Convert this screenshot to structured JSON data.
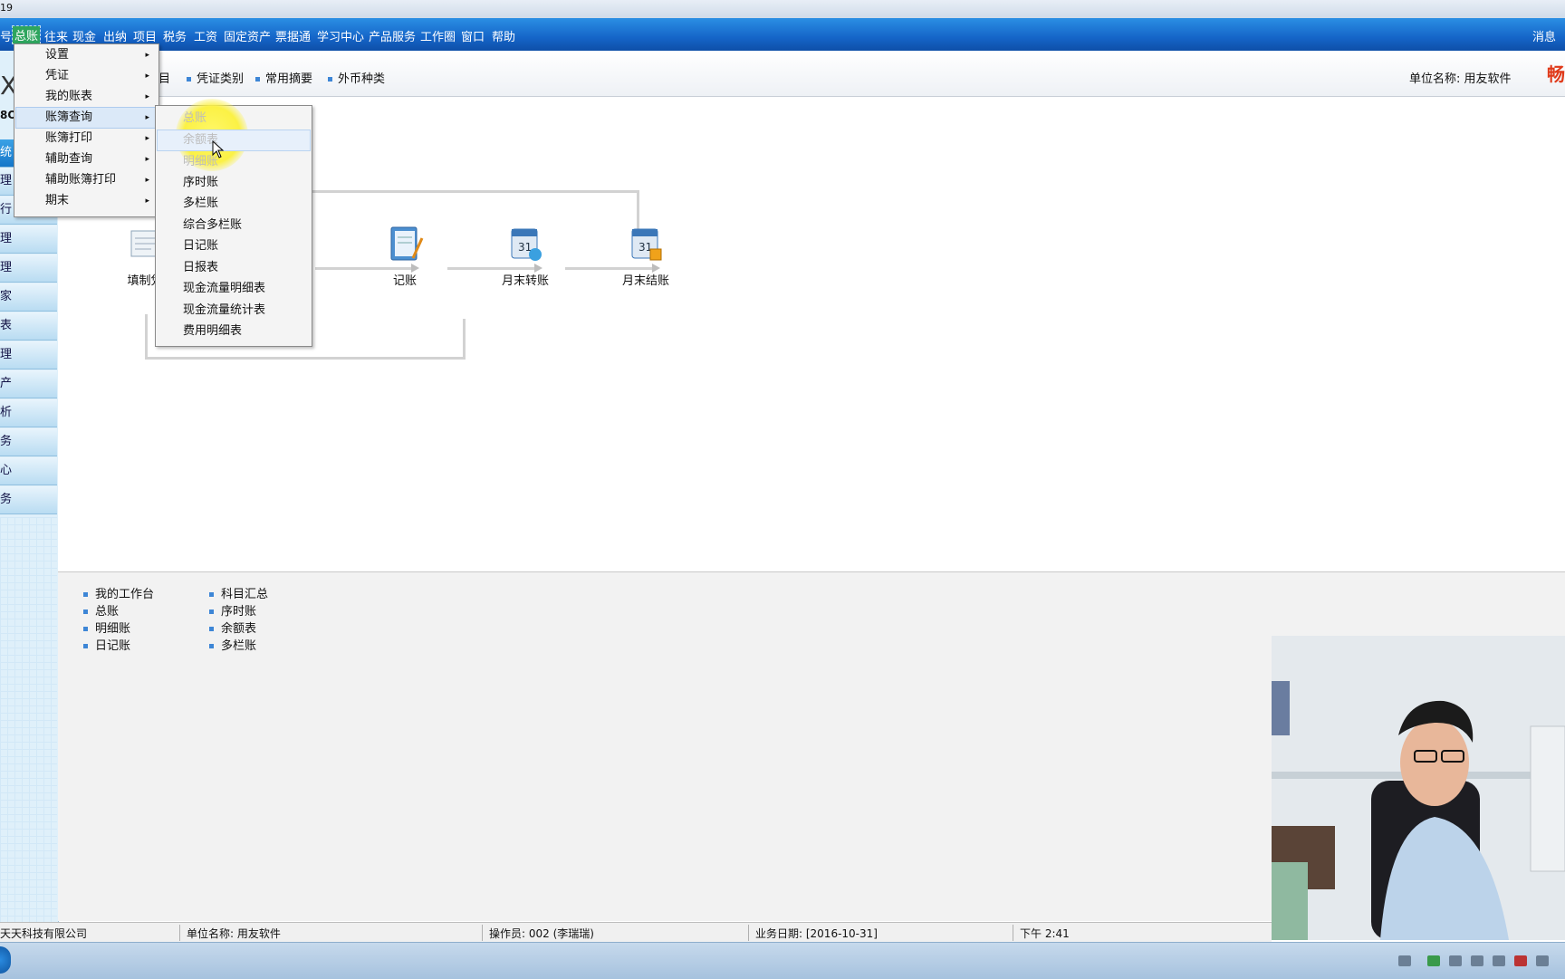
{
  "titlebar": {
    "text": "19"
  },
  "menubar": {
    "items": [
      "号",
      "总账",
      "往来",
      "现金",
      "出纳",
      "项目",
      "税务",
      "工资",
      "固定资产",
      "票据通",
      "学习中心",
      "产品服务",
      "工作圈",
      "窗口",
      "帮助"
    ],
    "right": "消息"
  },
  "toolbar": {
    "partial_item": "目",
    "items": [
      "凭证类别",
      "常用摘要",
      "外币种类"
    ],
    "company_label": "单位名称: 用友软件",
    "logo_text": "畅"
  },
  "sidebar": {
    "brand": "X",
    "brand2": "8O",
    "items": [
      "统",
      "理",
      "行",
      "理",
      "理",
      "家",
      "表",
      "理",
      "产",
      "析",
      "务",
      "心",
      "务"
    ]
  },
  "menu": {
    "items": [
      {
        "label": "设置",
        "has_sub": true
      },
      {
        "label": "凭证",
        "has_sub": true
      },
      {
        "label": "我的账表",
        "has_sub": true
      },
      {
        "label": "账簿查询",
        "has_sub": true
      },
      {
        "label": "账簿打印",
        "has_sub": true
      },
      {
        "label": "辅助查询",
        "has_sub": true
      },
      {
        "label": "辅助账簿打印",
        "has_sub": true
      },
      {
        "label": "期末",
        "has_sub": true
      }
    ],
    "caret": "▸"
  },
  "submenu": {
    "items": [
      "总账",
      "余额表",
      "明细账",
      "序时账",
      "多栏账",
      "综合多栏账",
      "日记账",
      "日报表",
      "现金流量明细表",
      "现金流量统计表",
      "费用明细表"
    ]
  },
  "flow": {
    "nodes": [
      "填制凭",
      "记账",
      "月末转账",
      "月末结账"
    ]
  },
  "shortcuts": {
    "col1": [
      "我的工作台",
      "总账",
      "明细账",
      "日记账"
    ],
    "col2": [
      "科目汇总",
      "序时账",
      "余额表",
      "多栏账"
    ]
  },
  "status": {
    "company": "天天科技有限公司",
    "unit": "单位名称: 用友软件",
    "operator": "操作员: 002 (李瑞瑞)",
    "date": "业务日期: [2016-10-31]",
    "time": "下午 2:41"
  },
  "colors": {
    "menubar": "#1565c8",
    "highlight": "#dbe9f8",
    "spot": "#fbf145"
  }
}
